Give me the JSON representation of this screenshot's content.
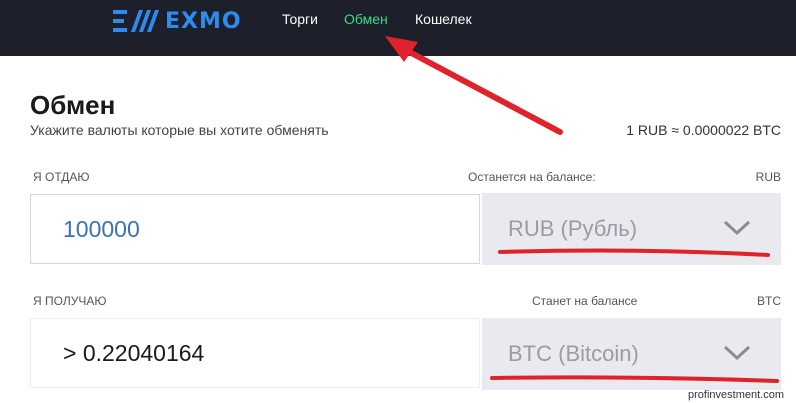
{
  "header": {
    "logo_text": "EXMO",
    "nav": [
      {
        "label": "Торги"
      },
      {
        "label": "Обмен"
      },
      {
        "label": "Кошелек"
      }
    ]
  },
  "page": {
    "title": "Обмен",
    "subtitle": "Укажите валюты которые вы хотите обменять",
    "rate": "1 RUB ≈ 0.0000022 BTC"
  },
  "give": {
    "label": "Я ОТДАЮ",
    "balance_label": "Останется на балансе:",
    "balance_currency": "RUB",
    "amount": "100000",
    "currency": "RUB (Рубль)"
  },
  "get": {
    "label": "Я ПОЛУЧАЮ",
    "balance_label": "Станет на балансе",
    "balance_currency": "BTC",
    "amount": "> 0.22040164",
    "currency": "BTC (Bitcoin)"
  },
  "watermark": "profinvestment.com",
  "colors": {
    "header_bg": "#1d1f2b",
    "brand": "#2d8cf0",
    "active_nav": "#3ddc84",
    "annotation": "#e0232b"
  }
}
